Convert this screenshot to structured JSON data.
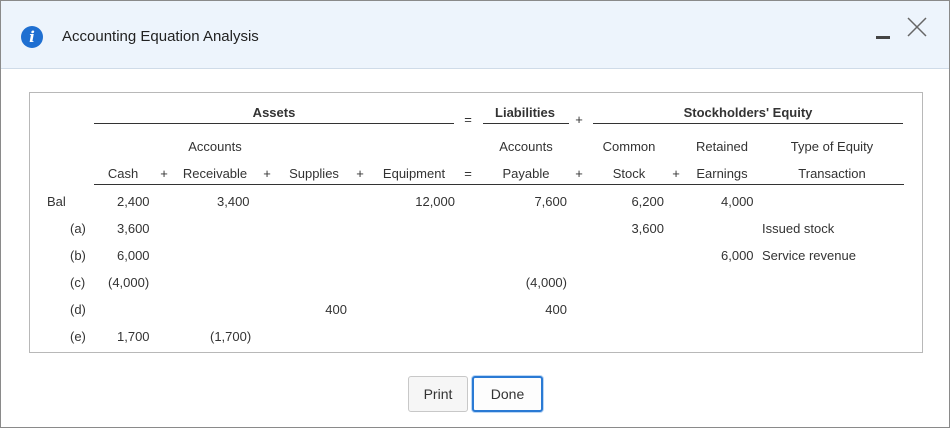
{
  "dialog": {
    "title": "Accounting Equation Analysis",
    "icon": "info-icon",
    "accent_color": "#1f6fd1"
  },
  "headers": {
    "assets": "Assets",
    "equals": "=",
    "liabilities": "Liabilities",
    "plus": "+",
    "equity": "Stockholders' Equity",
    "accounts_top": "Accounts",
    "accounts_top2": "Accounts",
    "common": "Common",
    "retained": "Retained",
    "type_equity": "Type of Equity",
    "cash": "Cash",
    "receivable": "Receivable",
    "supplies": "Supplies",
    "equipment": "Equipment",
    "payable": "Payable",
    "stock": "Stock",
    "earnings": "Earnings",
    "transaction": "Transaction"
  },
  "rows": [
    {
      "label": "Bal",
      "cash": "2,400",
      "receivable": "3,400",
      "supplies": "",
      "equipment": "12,000",
      "payable": "7,600",
      "stock": "6,200",
      "earnings": "4,000",
      "type": ""
    },
    {
      "label": "(a)",
      "cash": "3,600",
      "receivable": "",
      "supplies": "",
      "equipment": "",
      "payable": "",
      "stock": "3,600",
      "earnings": "",
      "type": "Issued stock"
    },
    {
      "label": "(b)",
      "cash": "6,000",
      "receivable": "",
      "supplies": "",
      "equipment": "",
      "payable": "",
      "stock": "",
      "earnings": "6,000",
      "type": "Service revenue"
    },
    {
      "label": "(c)",
      "cash": "(4,000)",
      "receivable": "",
      "supplies": "",
      "equipment": "",
      "payable": "(4,000)",
      "stock": "",
      "earnings": "",
      "type": ""
    },
    {
      "label": "(d)",
      "cash": "",
      "receivable": "",
      "supplies": "400",
      "equipment": "",
      "payable": "400",
      "stock": "",
      "earnings": "",
      "type": ""
    },
    {
      "label": "(e)",
      "cash": "1,700",
      "receivable": "(1,700)",
      "supplies": "",
      "equipment": "",
      "payable": "",
      "stock": "",
      "earnings": "",
      "type": ""
    }
  ],
  "buttons": {
    "print": "Print",
    "done": "Done"
  }
}
